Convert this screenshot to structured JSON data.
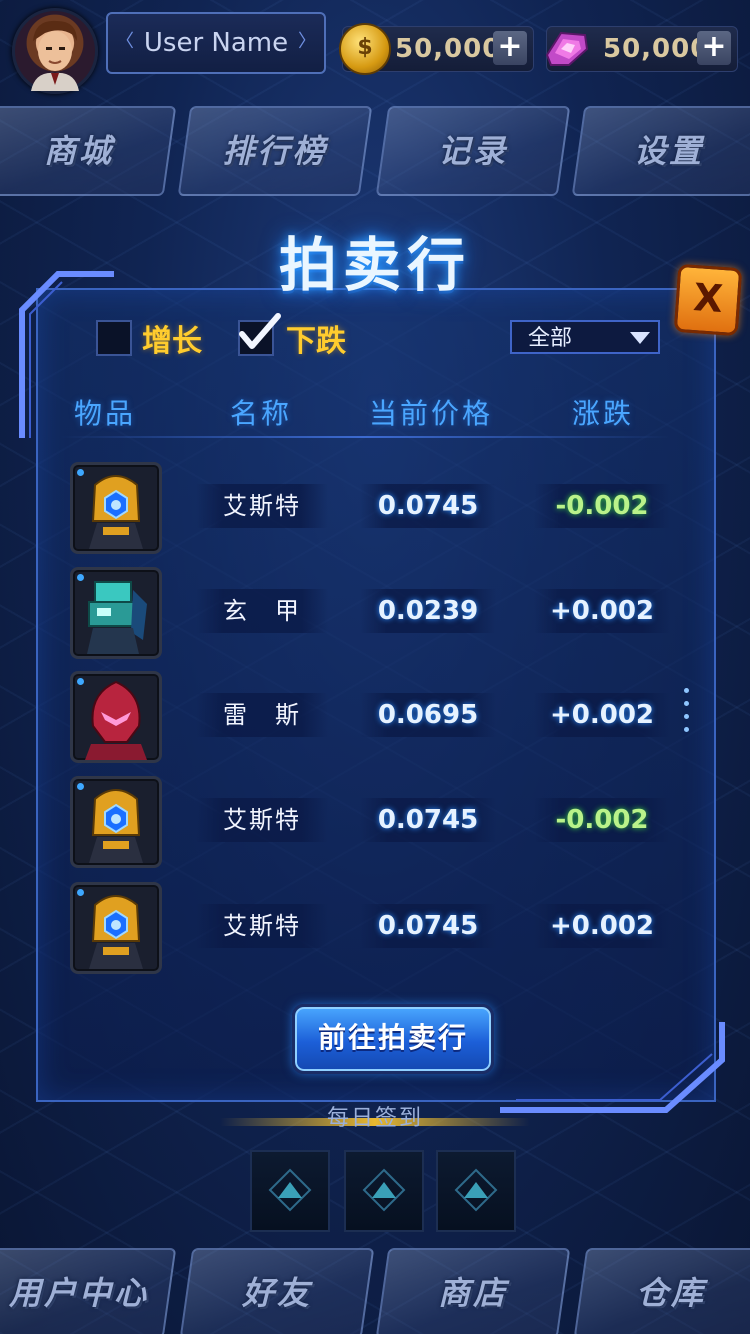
{
  "topbar": {
    "username": "User Name",
    "coins": "50,000",
    "gems": "50,000",
    "plus": "+"
  },
  "nav_top": [
    {
      "label": "商城"
    },
    {
      "label": "排行榜"
    },
    {
      "label": "记录"
    },
    {
      "label": "设置"
    }
  ],
  "auction": {
    "title": "拍卖行",
    "close_label": "X",
    "filters": {
      "rise_label": "增长",
      "rise_checked": false,
      "fall_label": "下跌",
      "fall_checked": true
    },
    "dropdown_value": "全部",
    "columns": [
      "物品",
      "名称",
      "当前价格",
      "涨跌"
    ],
    "rows": [
      {
        "icon": "gold-robot-icon",
        "name": "艾斯特",
        "price": "0.0745",
        "change": "-0.002",
        "trend": "down"
      },
      {
        "icon": "cyan-robot-icon",
        "name": "玄　甲",
        "price": "0.0239",
        "change": "+0.002",
        "trend": "up"
      },
      {
        "icon": "red-helmet-icon",
        "name": "雷　斯",
        "price": "0.0695",
        "change": "+0.002",
        "trend": "up"
      },
      {
        "icon": "gold-robot-icon",
        "name": "艾斯特",
        "price": "0.0745",
        "change": "-0.002",
        "trend": "down"
      },
      {
        "icon": "gold-robot-icon",
        "name": "艾斯特",
        "price": "0.0745",
        "change": "+0.002",
        "trend": "up"
      }
    ],
    "goto_button": "前往拍卖行"
  },
  "daily": {
    "label": "每日签到",
    "slots": 3
  },
  "nav_bottom": [
    {
      "label": "用户中心"
    },
    {
      "label": "好友"
    },
    {
      "label": "商店"
    },
    {
      "label": "仓库"
    }
  ],
  "colors": {
    "accent_blue": "#4aa6ff",
    "filter_yellow": "#ffcc2e",
    "change_negative": "#b9f28a",
    "close_orange": "#f0901c"
  }
}
